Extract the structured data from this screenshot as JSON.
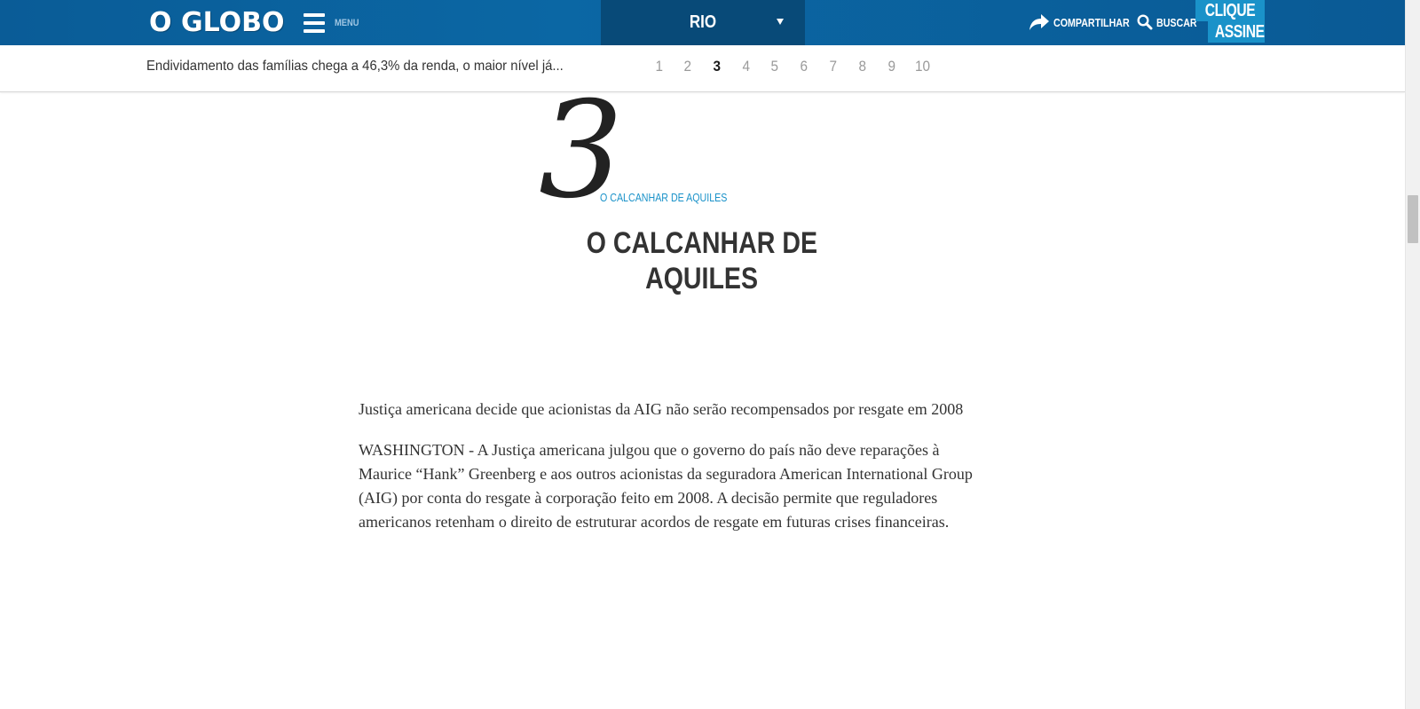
{
  "header": {
    "logo": "O GLOBO",
    "menu_label": "MENU",
    "region": "RIO",
    "share_label": "COMPARTILHAR",
    "search_label": "BUSCAR",
    "subscribe_line1": "CLIQUE E",
    "subscribe_line2": "ASSINE"
  },
  "subbar": {
    "story_title": "Endividamento das famílias chega a 46,3% da renda, o maior nível já...",
    "pages": [
      "1",
      "2",
      "3",
      "4",
      "5",
      "6",
      "7",
      "8",
      "9",
      "10"
    ],
    "active_page": "3"
  },
  "chapter": {
    "number": "3",
    "kicker": "O CALCANHAR DE AQUILES",
    "title_line1": "O CALCANHAR DE",
    "title_line2": "AQUILES"
  },
  "article": {
    "paragraphs": [
      "Justiça americana decide que acionistas da AIG não serão recompensados por resgate em 2008",
      "WASHINGTON - A Justiça americana julgou que o governo do país não deve reparações à Maurice “Hank” Greenberg e aos outros acionistas da seguradora American International Group (AIG) por conta do resgate à corporação feito em 2008. A decisão permite que reguladores americanos retenham o direito de estruturar acordos de resgate em futuras crises financeiras."
    ]
  },
  "colors": {
    "header_blue": "#0b67a4",
    "region_blue": "#084a78",
    "accent_cyan": "#1a92c9",
    "text_dark": "#333333"
  },
  "icons": {
    "menu": "hamburger-icon",
    "region": "caret-down-icon",
    "share": "share-arrow-icon",
    "search": "search-icon"
  }
}
